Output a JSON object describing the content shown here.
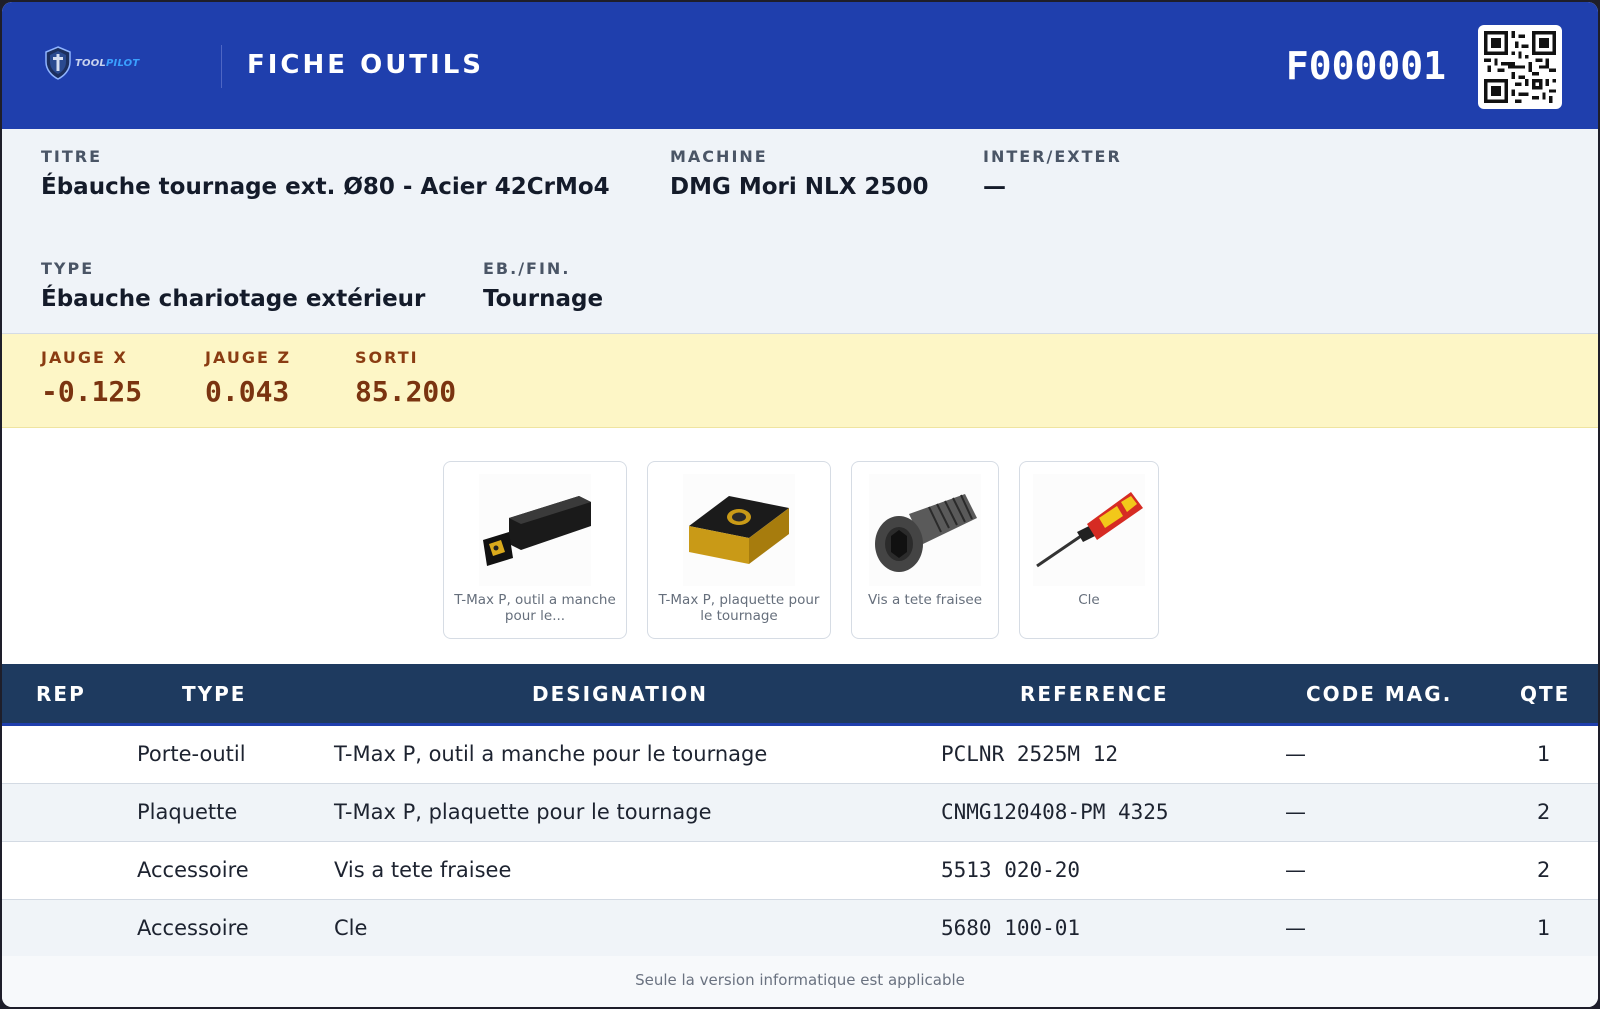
{
  "header": {
    "logo_text": "TOOLPILOT",
    "title": "FICHE OUTILS",
    "fiche_id": "F000001",
    "accent_color": "#1f3fad"
  },
  "info": {
    "titre_label": "TITRE",
    "titre_value": "Ébauche tournage ext. Ø80 - Acier 42CrMo4",
    "machine_label": "MACHINE",
    "machine_value": "DMG Mori NLX 2500",
    "inter_label": "INTER/EXTER",
    "inter_value": "—",
    "type_label": "TYPE",
    "type_value": "Ébauche chariotage extérieur",
    "ebfin_label": "EB./FIN.",
    "ebfin_value": "Tournage"
  },
  "gauge": {
    "x_label": "JAUGE X",
    "x_value": "-0.125",
    "z_label": "JAUGE Z",
    "z_value": "0.043",
    "sorti_label": "SORTI",
    "sorti_value": "85.200"
  },
  "cards": [
    {
      "label": "T-Max P, outil a manche pour le...",
      "icon": "tool-holder-icon"
    },
    {
      "label": "T-Max P, plaquette pour le tournage",
      "icon": "insert-icon"
    },
    {
      "label": "Vis a tete fraisee",
      "icon": "screw-icon"
    },
    {
      "label": "Cle",
      "icon": "screwdriver-icon"
    }
  ],
  "table": {
    "headers": {
      "rep": "REP",
      "type": "TYPE",
      "designation": "DESIGNATION",
      "reference": "REFERENCE",
      "code_mag": "CODE MAG.",
      "qte": "QTE"
    },
    "rows": [
      {
        "rep": "",
        "type": "Porte-outil",
        "designation": "T-Max P, outil a manche pour le tournage",
        "reference": "PCLNR 2525M 12",
        "code_mag": "—",
        "qte": "1"
      },
      {
        "rep": "",
        "type": "Plaquette",
        "designation": "T-Max P, plaquette pour le tournage",
        "reference": "CNMG120408-PM 4325",
        "code_mag": "—",
        "qte": "2"
      },
      {
        "rep": "",
        "type": "Accessoire",
        "designation": "Vis a tete fraisee",
        "reference": "5513 020-20",
        "code_mag": "—",
        "qte": "2"
      },
      {
        "rep": "",
        "type": "Accessoire",
        "designation": "Cle",
        "reference": "5680 100-01",
        "code_mag": "—",
        "qte": "1"
      }
    ]
  },
  "footer": {
    "text": "Seule la version informatique est applicable"
  }
}
